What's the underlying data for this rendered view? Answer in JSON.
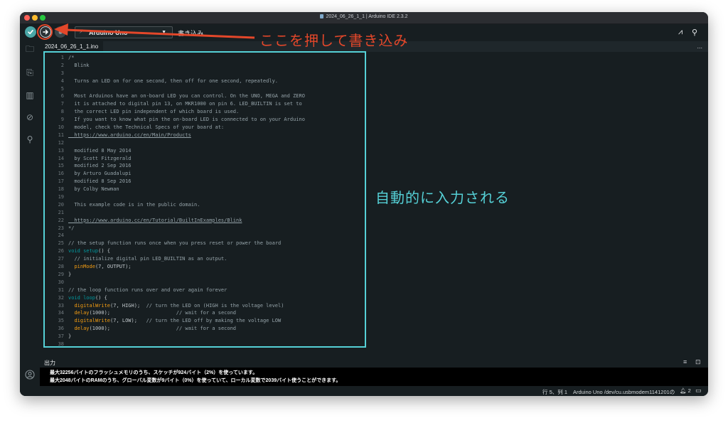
{
  "window": {
    "title": "2024_06_26_1_1 | Arduino IDE 2.3.2"
  },
  "toolbar": {
    "verify_icon": "check-icon",
    "upload_icon": "arrow-right-icon",
    "debug_icon": "debug-icon",
    "board_name": "Arduino Uno",
    "upload_tooltip": "書き込み",
    "serial_plotter_icon": "serial-plotter-icon",
    "serial_monitor_icon": "serial-monitor-icon"
  },
  "sidebar": {
    "items": [
      {
        "icon": "folder-icon",
        "glyph": "🗀"
      },
      {
        "icon": "board-manager-icon",
        "glyph": "⎘"
      },
      {
        "icon": "library-icon",
        "glyph": "▥"
      },
      {
        "icon": "debug-icon",
        "glyph": "⊘"
      },
      {
        "icon": "search-icon",
        "glyph": "⚲"
      }
    ],
    "account_icon": "account-icon"
  },
  "tab": {
    "filename": "2024_06_26_1_1.ino",
    "more": "..."
  },
  "editor": {
    "line_numbers": [
      "1",
      "2",
      "3",
      "4",
      "5",
      "6",
      "7",
      "8",
      "9",
      "10",
      "11",
      "12",
      "13",
      "14",
      "15",
      "16",
      "17",
      "18",
      "19",
      "20",
      "21",
      "22",
      "23",
      "24",
      "25",
      "26",
      "27",
      "28",
      "29",
      "30",
      "31",
      "32",
      "33",
      "34",
      "35",
      "36",
      "37",
      "38"
    ],
    "lines": [
      "/*",
      "  Blink",
      "",
      "  Turns an LED on for one second, then off for one second, repeatedly.",
      "",
      "  Most Arduinos have an on-board LED you can control. On the UNO, MEGA and ZERO",
      "  it is attached to digital pin 13, on MKR1000 on pin 6. LED_BUILTIN is set to",
      "  the correct LED pin independent of which board is used.",
      "  If you want to know what pin the on-board LED is connected to on your Arduino",
      "  model, check the Technical Specs of your board at:",
      "  https://www.arduino.cc/en/Main/Products",
      "",
      "  modified 8 May 2014",
      "  by Scott Fitzgerald",
      "  modified 2 Sep 2016",
      "  by Arturo Guadalupi",
      "  modified 8 Sep 2016",
      "  by Colby Newman",
      "",
      "  This example code is in the public domain.",
      "",
      "  https://www.arduino.cc/en/Tutorial/BuiltInExamples/Blink",
      "*/",
      "",
      "// the setup function runs once when you press reset or power the board",
      "void setup() {",
      "  // initialize digital pin LED_BUILTIN as an output.",
      "  pinMode(7, OUTPUT);",
      "}",
      "",
      "// the loop function runs over and over again forever",
      "void loop() {",
      "  digitalWrite(7, HIGH);  // turn the LED on (HIGH is the voltage level)",
      "  delay(1000);                      // wait for a second",
      "  digitalWrite(7, LOW);   // turn the LED off by making the voltage LOW",
      "  delay(1000);                      // wait for a second",
      "}",
      ""
    ]
  },
  "output": {
    "title": "出力",
    "clear_icon": "clear-output-icon",
    "lock_icon": "lock-icon",
    "lines": [
      "最大32256バイトのフラッシュメモリのうち、スケッチが924バイト（2%）を使っています。",
      "最大2048バイトのRAMのうち、グローバル変数が9バイト（0%）を使っていて、ローカル変数で2039バイト使うことができます。"
    ]
  },
  "status": {
    "position": "行 5、列 1",
    "board_port": "Arduino Uno /dev/cu.usbmodem1141201の",
    "notifications": "2",
    "notification_icon": "bell-icon",
    "panel_icon": "toggle-panel-icon"
  },
  "annotations": {
    "upload_note": "ここを押して書き込み",
    "auto_note": "自動的に入力される",
    "upload_color": "#e3472a",
    "editor_color": "#55d0d6"
  },
  "colors": {
    "editor_bg": "#171e21",
    "accent": "#4aa6a6",
    "keyword": "#00979d",
    "function": "#f39c12"
  }
}
